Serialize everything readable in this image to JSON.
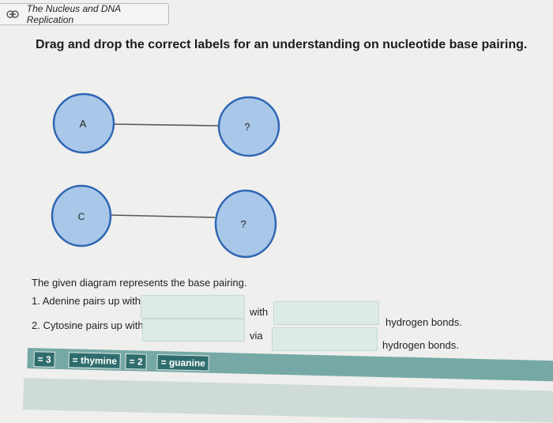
{
  "link": {
    "icon": "link-icon",
    "title": "The Nucleus and DNA Replication"
  },
  "question": "Drag and drop the correct labels for an understanding on nucleotide base pairing.",
  "diagram": {
    "pairs": [
      {
        "left": "A",
        "right": "?"
      },
      {
        "left": "C",
        "right": "?"
      }
    ],
    "colors": {
      "circle_fill": "#a9c7e8",
      "circle_stroke": "#2f66b3"
    }
  },
  "description": "The given diagram represents the base pairing.",
  "statements": [
    {
      "text": "1. Adenine pairs up with",
      "connector": "with",
      "suffix": "hydrogen bonds."
    },
    {
      "text": "2. Cytosine pairs up with",
      "connector": "via",
      "suffix": "hydrogen bonds."
    }
  ],
  "labels": [
    "= 3",
    "= thymine",
    "= 2",
    "= guanine"
  ],
  "colors": {
    "bank": "#76a9a5",
    "chip": "#2f6d6d",
    "drop_zone": "#dcebe6"
  }
}
